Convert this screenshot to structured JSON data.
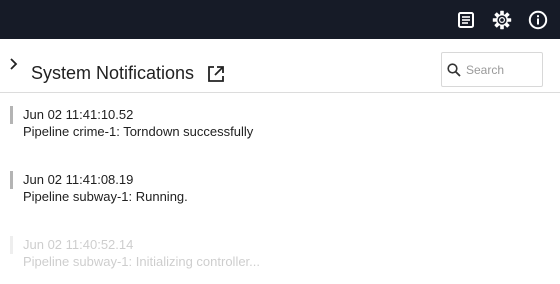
{
  "topbar": {
    "icons": [
      "notes-icon",
      "gear-icon",
      "info-icon"
    ],
    "background": "#161b27"
  },
  "panel": {
    "title": "System Notifications",
    "search": {
      "placeholder": "Search",
      "value": ""
    }
  },
  "notifications": [
    {
      "time": "Jun 02 11:41:10.52",
      "message": "Pipeline crime-1: Torndown successfully"
    },
    {
      "time": "Jun 02 11:41:08.19",
      "message": "Pipeline subway-1: Running."
    },
    {
      "time": "Jun 02 11:40:52.14",
      "message": "Pipeline subway-1: Initializing controller..."
    }
  ]
}
